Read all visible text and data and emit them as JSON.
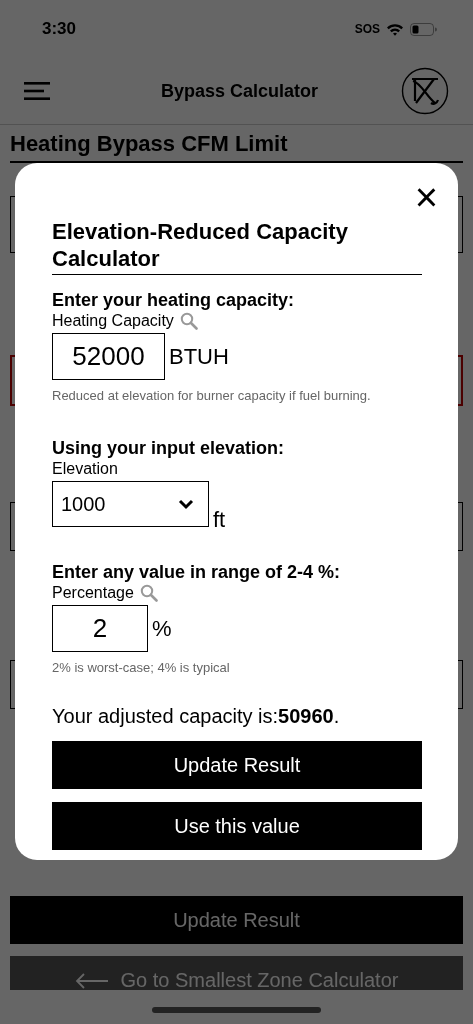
{
  "status_bar": {
    "time": "3:30",
    "carrier": "SOS"
  },
  "nav": {
    "title": "Bypass Calculator"
  },
  "page": {
    "heading": "Heating Bypass CFM Limit",
    "items": [
      {
        "kind": "field"
      },
      {
        "kind": "field_error"
      },
      {
        "kind": "field"
      },
      {
        "kind": "field"
      }
    ],
    "buttons": [
      {
        "label": "Update Result",
        "kind": "primary"
      },
      {
        "label": "Go to Smallest Zone Calculator",
        "kind": "nav_back"
      }
    ]
  },
  "modal": {
    "close": "×",
    "title": "Elevation-Reduced Capacity Calculator",
    "sections": [
      {
        "prompt": "Enter your heating capacity:",
        "label": "Heating Capacity",
        "lookup": true,
        "kind": "input",
        "value": "52000",
        "unit": "BTUH",
        "note": "Reduced at elevation for burner capacity if fuel burning."
      },
      {
        "prompt": "Using your input elevation:",
        "label": "Elevation",
        "lookup": false,
        "kind": "select",
        "value": "1000",
        "unit": "ft"
      },
      {
        "prompt": "Enter any value in range of 2-4 %:",
        "label": "Percentage",
        "lookup": true,
        "kind": "input_small",
        "value": "2",
        "unit": "%",
        "note": "2% is worst-case; 4% is typical"
      }
    ],
    "result": "Your adjusted capacity is:**50960**.",
    "buttons": [
      "Update Result",
      "Use this value"
    ]
  }
}
